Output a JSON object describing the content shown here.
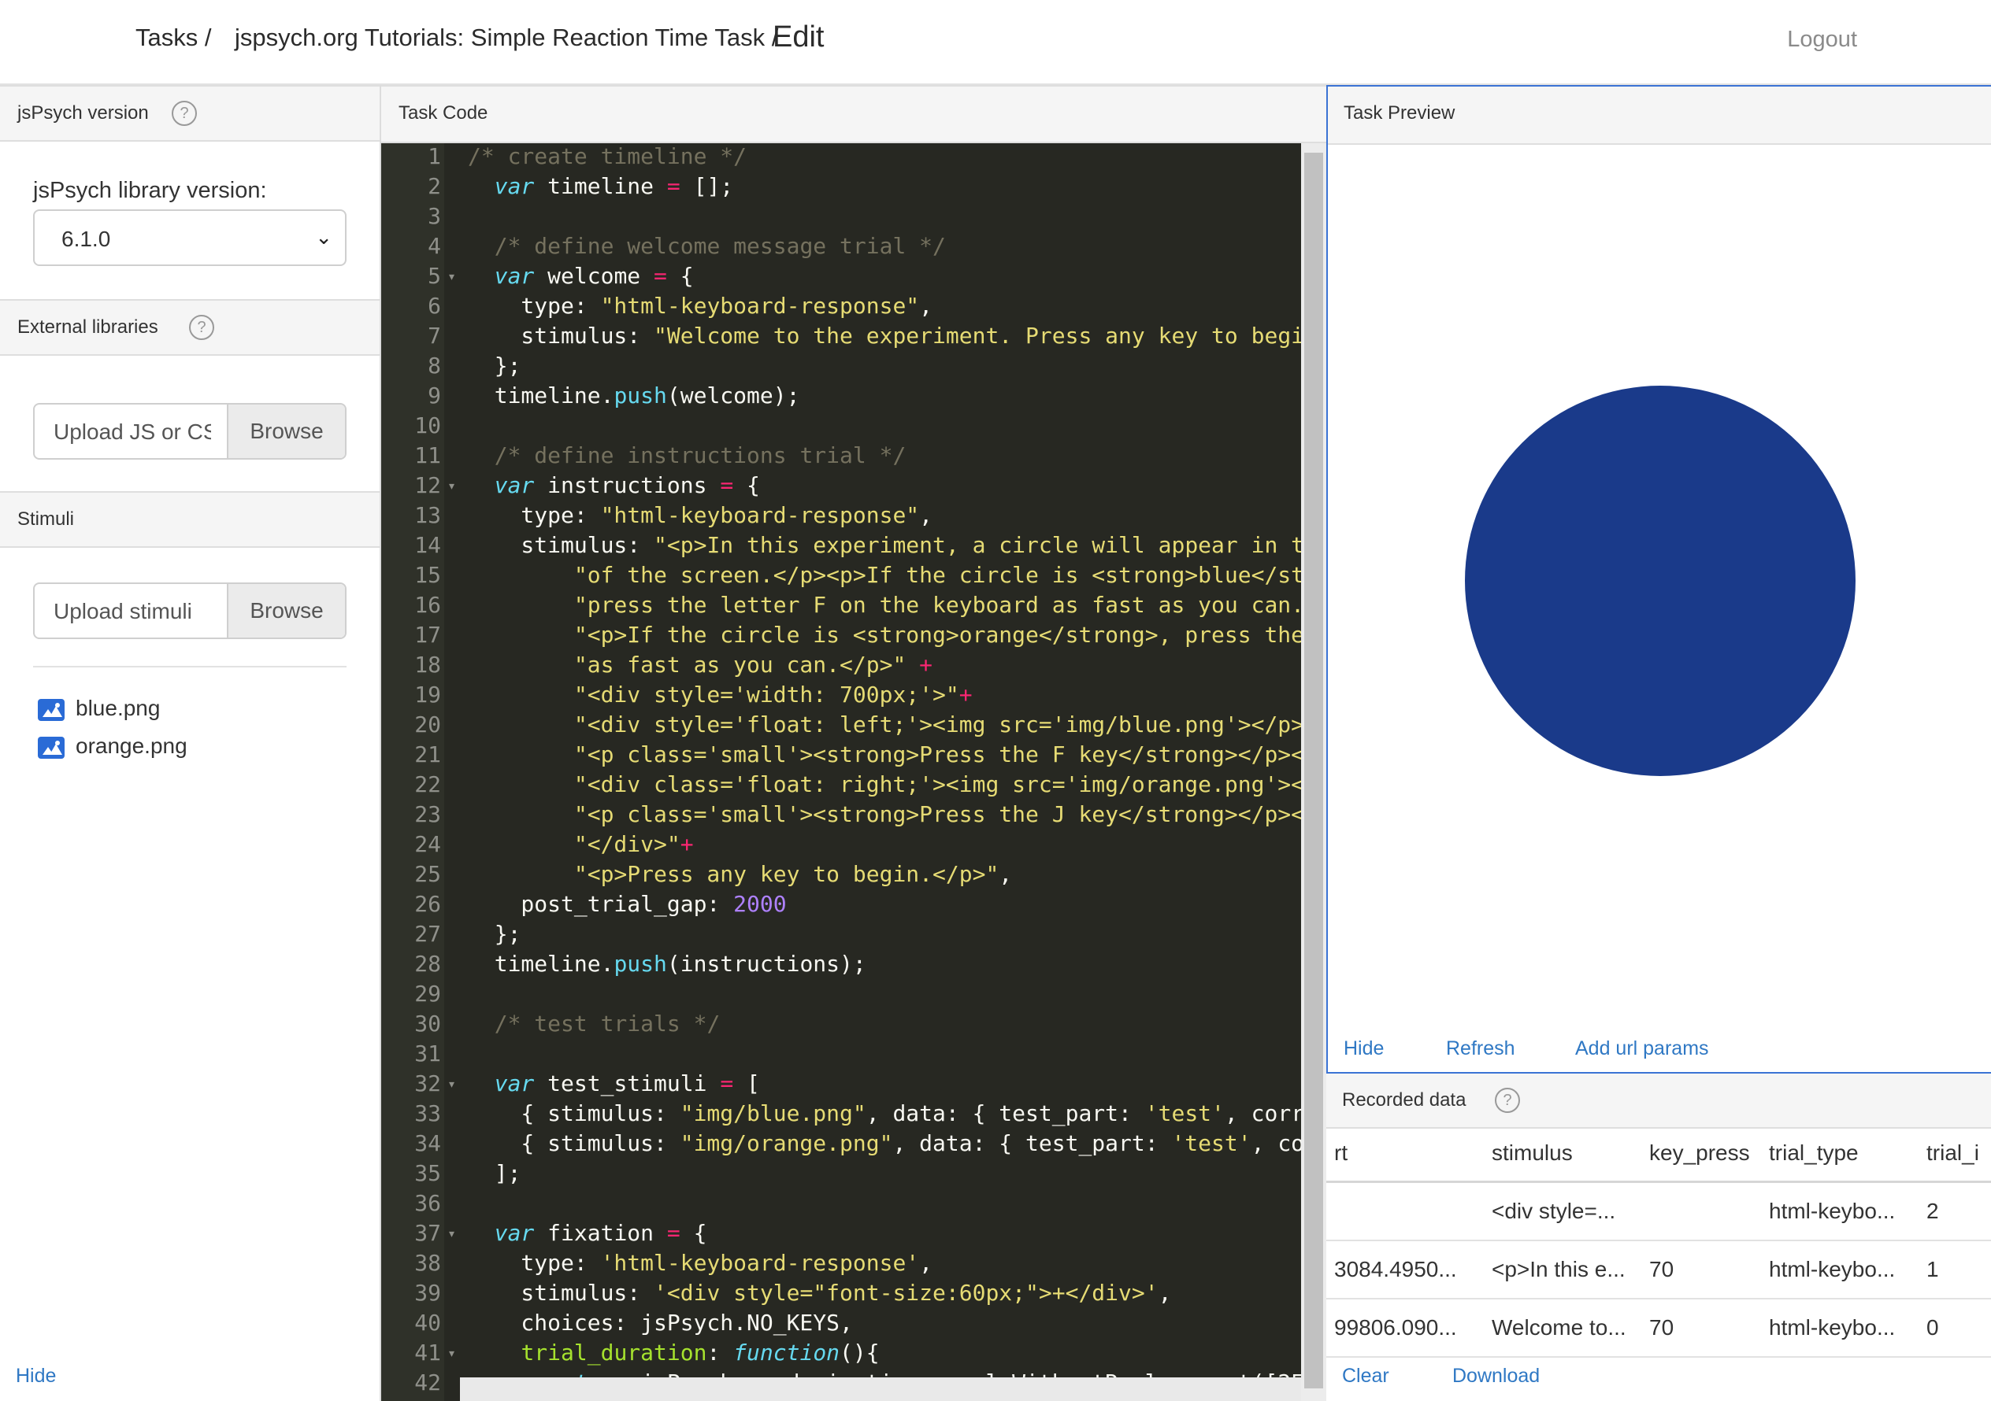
{
  "header": {
    "crumb_tasks": "Tasks /",
    "crumb_task": "jspsych.org Tutorials: Simple Reaction Time Task /",
    "crumb_edit": "Edit",
    "logout": "Logout"
  },
  "left": {
    "version_title": "jsPsych version",
    "version_label": "jsPsych library version:",
    "version_value": "6.1.0",
    "ext_title": "External libraries",
    "ext_placeholder": "Upload JS or CSS",
    "ext_browse": "Browse",
    "stimuli_title": "Stimuli",
    "stimuli_placeholder": "Upload stimuli",
    "stimuli_browse": "Browse",
    "files": [
      "blue.png",
      "orange.png"
    ],
    "hide": "Hide"
  },
  "code": {
    "title": "Task Code",
    "line_count": 42
  },
  "preview": {
    "title": "Task Preview",
    "hide": "Hide",
    "refresh": "Refresh",
    "add_params": "Add url params",
    "circle_color": "#1a3a8a"
  },
  "recorded": {
    "title": "Recorded data",
    "columns": [
      "rt",
      "stimulus",
      "key_press",
      "trial_type",
      "trial_i"
    ],
    "rows": [
      [
        "",
        "<div style=...",
        "",
        "html-keybo...",
        "2"
      ],
      [
        "3084.4950...",
        "<p>In this e...",
        "70",
        "html-keybo...",
        "1"
      ],
      [
        "99806.090...",
        "Welcome to...",
        "70",
        "html-keybo...",
        "0"
      ]
    ],
    "clear": "Clear",
    "download": "Download"
  }
}
